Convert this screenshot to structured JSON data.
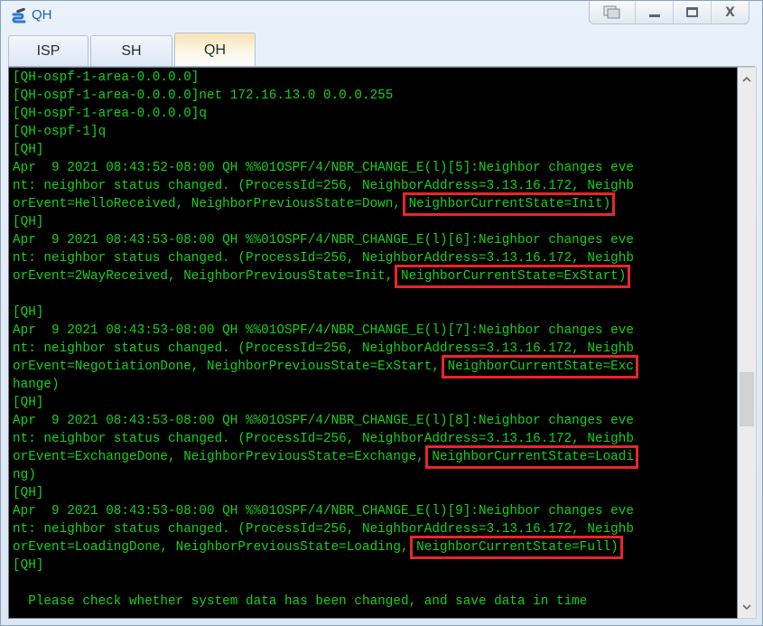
{
  "window": {
    "title": "QH",
    "icon": "network-link-icon",
    "controls": {
      "restore_label": "",
      "minimize_label": "_",
      "maximize_label": "□",
      "close_label": "X"
    }
  },
  "tabs": [
    {
      "label": "ISP",
      "active": false
    },
    {
      "label": "SH",
      "active": false
    },
    {
      "label": "QH",
      "active": true
    }
  ],
  "terminal": {
    "lines": [
      "[QH-ospf-1-area-0.0.0.0]",
      "[QH-ospf-1-area-0.0.0.0]net 172.16.13.0 0.0.0.255",
      "[QH-ospf-1-area-0.0.0.0]q",
      "[QH-ospf-1]q",
      "[QH]",
      "Apr  9 2021 08:43:52-08:00 QH %%01OSPF/4/NBR_CHANGE_E(l)[5]:Neighbor changes eve",
      "nt: neighbor status changed. (ProcessId=256, NeighborAddress=3.13.16.172, Neighb",
      "orEvent=HelloReceived, NeighborPreviousState=Down, NeighborCurrentState=Init)",
      "[QH]",
      "Apr  9 2021 08:43:53-08:00 QH %%01OSPF/4/NBR_CHANGE_E(l)[6]:Neighbor changes eve",
      "nt: neighbor status changed. (ProcessId=256, NeighborAddress=3.13.16.172, Neighb",
      "orEvent=2WayReceived, NeighborPreviousState=Init, NeighborCurrentState=ExStart)",
      "",
      "[QH]",
      "Apr  9 2021 08:43:53-08:00 QH %%01OSPF/4/NBR_CHANGE_E(l)[7]:Neighbor changes eve",
      "nt: neighbor status changed. (ProcessId=256, NeighborAddress=3.13.16.172, Neighb",
      "orEvent=NegotiationDone, NeighborPreviousState=ExStart, NeighborCurrentState=Exc",
      "hange)",
      "[QH]",
      "Apr  9 2021 08:43:53-08:00 QH %%01OSPF/4/NBR_CHANGE_E(l)[8]:Neighbor changes eve",
      "nt: neighbor status changed. (ProcessId=256, NeighborAddress=3.13.16.172, Neighb",
      "orEvent=ExchangeDone, NeighborPreviousState=Exchange, NeighborCurrentState=Loadi",
      "ng)",
      "[QH]",
      "Apr  9 2021 08:43:53-08:00 QH %%01OSPF/4/NBR_CHANGE_E(l)[9]:Neighbor changes eve",
      "nt: neighbor status changed. (ProcessId=256, NeighborAddress=3.13.16.172, Neighb",
      "orEvent=LoadingDone, NeighborPreviousState=Loading, NeighborCurrentState=Full)",
      "[QH]",
      "",
      "  Please check whether system data has been changed, and save data in time"
    ],
    "highlights": [
      {
        "text": "NeighborCurrentState=Init)",
        "line": 7
      },
      {
        "text": "NeighborCurrentState=ExStart)",
        "line": 11
      },
      {
        "text": "NeighborCurrentState=Exc",
        "line": 16
      },
      {
        "text": "NeighborCurrentState=Loadi",
        "line": 21
      },
      {
        "text": "NeighborCurrentState=Full)",
        "line": 26
      }
    ],
    "text_color": "#16d21a",
    "background_color": "#000000",
    "highlight_color": "#e8262a"
  },
  "scrollbar": {
    "up_label": "^",
    "down_label": "v"
  }
}
